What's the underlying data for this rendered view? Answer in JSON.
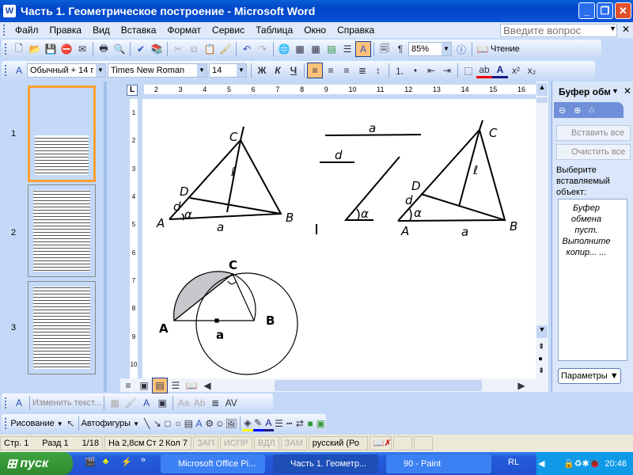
{
  "window": {
    "title": "Часть 1. Геометрическое построение - Microsoft Word"
  },
  "menu": {
    "items": [
      "Файл",
      "Правка",
      "Вид",
      "Вставка",
      "Формат",
      "Сервис",
      "Таблица",
      "Окно",
      "Справка"
    ],
    "ask_placeholder": "Введите вопрос"
  },
  "toolbar": {
    "zoom": "85%",
    "reading": "Чтение"
  },
  "format": {
    "style": "Обычный + 14 г",
    "font": "Times New Roman",
    "size": "14",
    "bold": "Ж",
    "italic": "К",
    "underline": "Ч"
  },
  "thumbnails": [
    "1",
    "2",
    "3"
  ],
  "ruler": {
    "h_ticks": [
      "2",
      "3",
      "4",
      "5",
      "6",
      "7",
      "8",
      "9",
      "10",
      "11",
      "12",
      "13",
      "14",
      "15",
      "16"
    ],
    "v_ticks": [
      "1",
      "2",
      "3",
      "4",
      "5",
      "6",
      "7",
      "8",
      "9",
      "10"
    ]
  },
  "diagram": {
    "labels": {
      "C": "C",
      "l": "ℓ",
      "D": "D",
      "d": "d",
      "alpha": "α",
      "A": "A",
      "a": "a",
      "B": "B"
    }
  },
  "taskpane": {
    "title": "Буфер обм",
    "paste_all": "Вставить все",
    "clear_all": "Очистить все",
    "prompt": "Выберите вставляемый объект:",
    "empty_msg": "Буфер обмена пуст. Выполните копир... ...",
    "options": "Параметры"
  },
  "wordart_toolbar": {
    "edit_text": "Изменить текст..."
  },
  "drawing_toolbar": {
    "drawing": "Рисование",
    "autoshapes": "Автофигуры"
  },
  "status": {
    "page": "Стр. 1",
    "section": "Разд 1",
    "pages": "1/18",
    "at": "На 2,8см",
    "line": "Ст 2",
    "col": "Кол 7",
    "rec": "ЗАП",
    "trk": "ИСПР",
    "ext": "ВДЛ",
    "ovr": "ЗАМ",
    "lang": "русский (Ро"
  },
  "taskbar": {
    "start": "пуск",
    "tasks": [
      "Microsoft Office Pi...",
      "Часть 1. Геометр...",
      "90 - Paint"
    ],
    "lang": "RL",
    "time": "20:46"
  },
  "colors": {
    "title": "#0a5fd6",
    "highlight": "#ffc27a",
    "taskbar": "#245ddb",
    "start": "#3fa33f"
  }
}
